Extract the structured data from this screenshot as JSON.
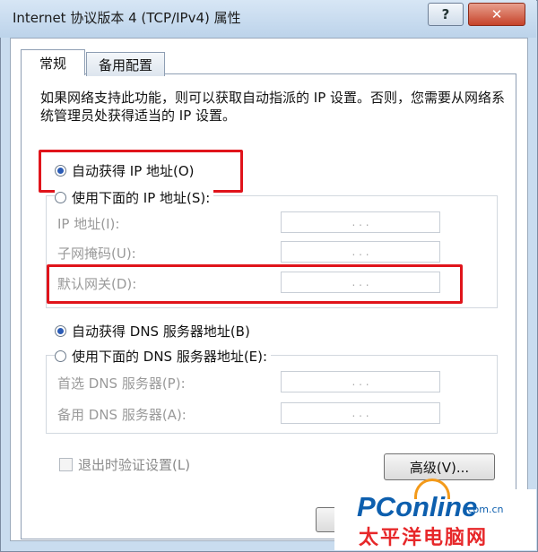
{
  "window": {
    "title": "Internet 协议版本 4 (TCP/IPv4) 属性",
    "help_label": "?",
    "close_label": "✕"
  },
  "tabs": [
    {
      "label": "常规"
    },
    {
      "label": "备用配置"
    }
  ],
  "description": "如果网络支持此功能，则可以获取自动指派的 IP 设置。否则，您需要从网络系统管理员处获得适当的 IP 设置。",
  "ip": {
    "auto_label": "自动获得 IP 地址(O)",
    "manual_label": "使用下面的 IP 地址(S):",
    "auto_selected": true,
    "fields": [
      {
        "label": "IP 地址(I):",
        "value": ".   .   ."
      },
      {
        "label": "子网掩码(U):",
        "value": ".   .   ."
      },
      {
        "label": "默认网关(D):",
        "value": ".   .   ."
      }
    ]
  },
  "dns": {
    "auto_label": "自动获得 DNS 服务器地址(B)",
    "manual_label": "使用下面的 DNS 服务器地址(E):",
    "auto_selected": true,
    "fields": [
      {
        "label": "首选 DNS 服务器(P):",
        "value": ".   .   ."
      },
      {
        "label": "备用 DNS 服务器(A):",
        "value": ".   .   ."
      }
    ]
  },
  "validate_label": "退出时验证设置(L)",
  "advanced_label": "高级(V)...",
  "watermark": {
    "brand": "PConline",
    "domain": ".com.cn",
    "name": "太平洋电脑网"
  },
  "colors": {
    "highlight": "#e0141b",
    "radio_dot": "#2a5bb5"
  }
}
